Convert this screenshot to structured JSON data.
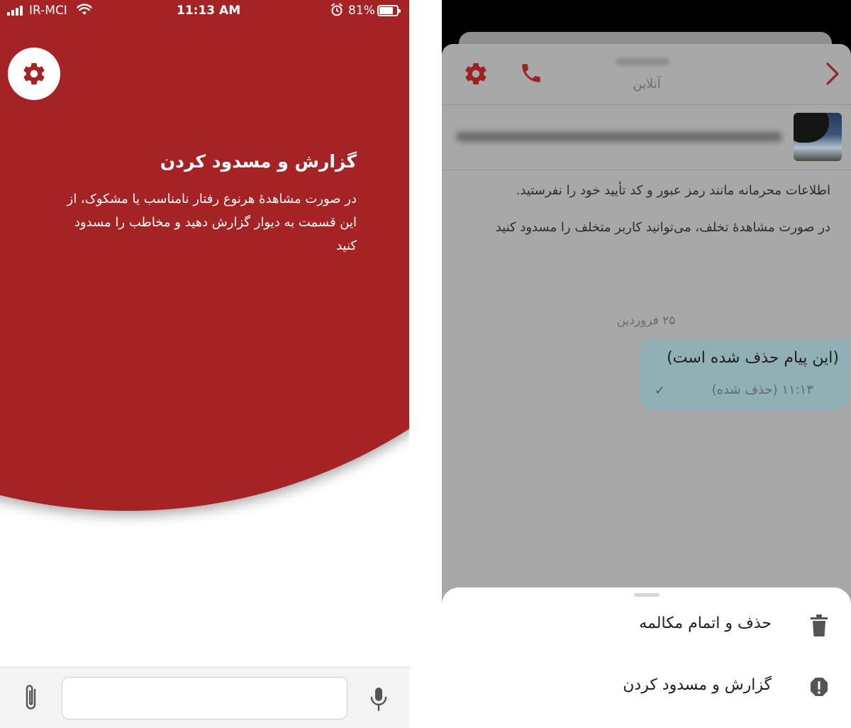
{
  "left_screen": {
    "status_bar": {
      "carrier": "IR-MCI",
      "time": "11:13 AM",
      "battery": "81%"
    },
    "intro_title": "گزارش و مسدود کردن",
    "intro_text": "در صورت مشاهدهٔ هرنوع رفتار نامناسب یا مشکوک، از این قسمت به دیوار گزارش دهید و مخاطب را مسدود کنید",
    "message_input": {
      "value": "",
      "placeholder": ""
    },
    "icons": {
      "settings": "gear-icon",
      "attach": "paperclip-icon",
      "mic": "microphone-icon"
    },
    "colors": {
      "brand": "#a52325",
      "background": "#ffffff"
    }
  },
  "right_screen": {
    "header": {
      "status": "آنلاین"
    },
    "system_messages": [
      "اطلاعات محرمانه مانند رمز عبور و کد تأیید خود را نفرستید.",
      "در صورت مشاهدهٔ تخلف، می‌توانید کاربر متخلف را مسدود کنید"
    ],
    "date_chip": "۲۵ فروردین",
    "message": {
      "text": "(این پیام حذف شده است)",
      "meta": "۱۱:۱۳ (حذف شده)",
      "tick": "✓"
    },
    "sheet_items": [
      {
        "label": "حذف و اتمام مکالمه",
        "icon": "trash-icon"
      },
      {
        "label": "گزارش و مسدود کردن",
        "icon": "alert-octagon-icon"
      }
    ],
    "icons": {
      "settings": "gear-icon",
      "call": "phone-icon",
      "back": "chevron-right-icon"
    },
    "colors": {
      "accent": "#a52325",
      "overlay": "#a8a8a8",
      "bubble": "#8fb0b4"
    }
  }
}
